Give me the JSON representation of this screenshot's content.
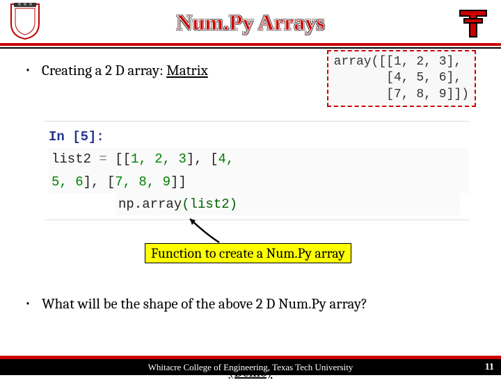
{
  "header": {
    "title": "Num.Py Arrays"
  },
  "bullet1": {
    "prefix": "Creating a 2 D array: ",
    "underlined": "Matrix"
  },
  "output": {
    "line1": "array([[1, 2, 3],",
    "line2": "       [4, 5, 6],",
    "line3": "       [7, 8, 9]])"
  },
  "code": {
    "prompt": "In [5]:",
    "line1_a": "list2 ",
    "line1_eq": "=",
    "line1_b": " [[",
    "line1_nums": "1, 2, 3",
    "line1_c": "], [",
    "line1_nums2": "4, 5, 6",
    "line1_d": "], [",
    "line1_nums3": "7, 8, 9",
    "line1_e": "]]",
    "line2_a": "np.array",
    "line2_b": "(list2)"
  },
  "callout": "Function to create a Num.Py array",
  "bullet2": "What will be the shape of the above 2 D Num.Py array?",
  "demo": "(Demo)",
  "footer": "Whitacre College of Engineering, Texas Tech University",
  "page": "11"
}
